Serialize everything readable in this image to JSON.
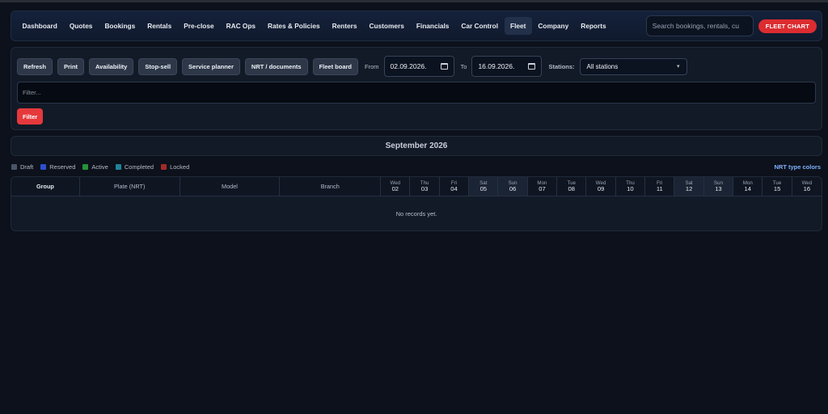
{
  "nav": {
    "items": [
      {
        "label": "Dashboard",
        "name": "nav-dashboard"
      },
      {
        "label": "Quotes",
        "name": "nav-quotes"
      },
      {
        "label": "Bookings",
        "name": "nav-bookings"
      },
      {
        "label": "Rentals",
        "name": "nav-rentals"
      },
      {
        "label": "Pre-close",
        "name": "nav-pre-close"
      },
      {
        "label": "RAC Ops",
        "name": "nav-rac-ops"
      },
      {
        "label": "Rates & Policies",
        "name": "nav-rates-policies"
      },
      {
        "label": "Renters",
        "name": "nav-renters"
      },
      {
        "label": "Customers",
        "name": "nav-customers"
      },
      {
        "label": "Financials",
        "name": "nav-financials"
      },
      {
        "label": "Car Control",
        "name": "nav-car-control"
      },
      {
        "label": "Fleet",
        "name": "nav-fleet",
        "active": true
      },
      {
        "label": "Company",
        "name": "nav-company"
      },
      {
        "label": "Reports",
        "name": "nav-reports"
      }
    ],
    "search_placeholder": "Search bookings, rentals, cu",
    "fleet_chart_label": "FLEET CHART"
  },
  "toolbar": {
    "buttons": [
      {
        "label": "Refresh",
        "name": "refresh-button"
      },
      {
        "label": "Print",
        "name": "print-button"
      },
      {
        "label": "Availability",
        "name": "availability-button"
      },
      {
        "label": "Stop-sell",
        "name": "stop-sell-button"
      },
      {
        "label": "Service planner",
        "name": "service-planner-button"
      },
      {
        "label": "NRT / documents",
        "name": "nrt-documents-button"
      },
      {
        "label": "Fleet board",
        "name": "fleet-board-button"
      }
    ],
    "from_label": "From",
    "from_value": "02.09.2026.",
    "to_label": "To",
    "to_value": "16.09.2026.",
    "stations_label": "Stations:",
    "stations_value": "All stations",
    "filter_placeholder": "Filter...",
    "filter_button": "Filter"
  },
  "month_title": "September 2026",
  "legend": {
    "items": [
      {
        "label": "Draft",
        "color": "#4a5568"
      },
      {
        "label": "Reserved",
        "color": "#2b4fd1"
      },
      {
        "label": "Active",
        "color": "#25913a"
      },
      {
        "label": "Completed",
        "color": "#1f8398"
      },
      {
        "label": "Locked",
        "color": "#a32a2a"
      }
    ],
    "nrt_link": "NRT type colors"
  },
  "grid": {
    "columns": {
      "group": "Group",
      "plate": "Plate (NRT)",
      "model": "Model",
      "branch": "Branch"
    },
    "days": [
      {
        "name": "Wed",
        "num": "02"
      },
      {
        "name": "Thu",
        "num": "03"
      },
      {
        "name": "Fri",
        "num": "04"
      },
      {
        "name": "Sat",
        "num": "05",
        "weekend": true
      },
      {
        "name": "Sun",
        "num": "06",
        "weekend": true
      },
      {
        "name": "Mon",
        "num": "07"
      },
      {
        "name": "Tue",
        "num": "08"
      },
      {
        "name": "Wed",
        "num": "09"
      },
      {
        "name": "Thu",
        "num": "10"
      },
      {
        "name": "Fri",
        "num": "11"
      },
      {
        "name": "Sat",
        "num": "12",
        "weekend": true
      },
      {
        "name": "Sun",
        "num": "13",
        "weekend": true
      },
      {
        "name": "Mon",
        "num": "14"
      },
      {
        "name": "Tue",
        "num": "15"
      },
      {
        "name": "Wed",
        "num": "16"
      }
    ],
    "empty_text": "No records yet."
  }
}
